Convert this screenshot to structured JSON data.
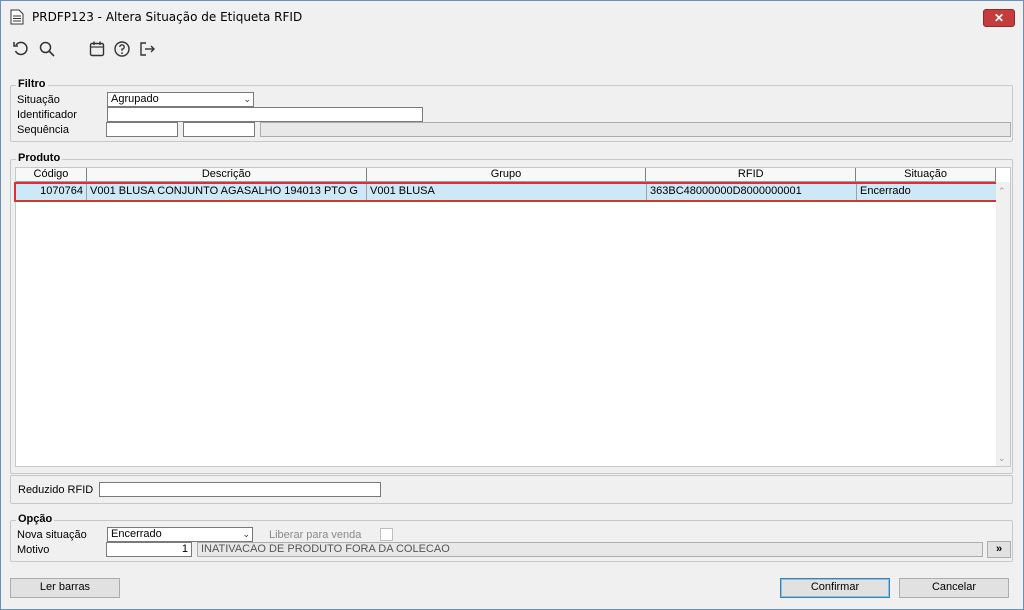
{
  "window": {
    "title": "PRDFP123 - Altera Situação de Etiqueta RFID",
    "close_label": "✕"
  },
  "toolbar": {
    "items": [
      {
        "name": "refresh-icon"
      },
      {
        "name": "search-icon"
      },
      {
        "name": "calendar-icon"
      },
      {
        "name": "help-icon"
      },
      {
        "name": "exit-icon"
      }
    ]
  },
  "filtro": {
    "title": "Filtro",
    "situacao_label": "Situação",
    "situacao_value": "Agrupado",
    "identificador_label": "Identificador",
    "identificador_value": "",
    "sequencia_label": "Sequência",
    "sequencia_from": "",
    "sequencia_to": ""
  },
  "produto": {
    "title": "Produto",
    "columns": [
      "Código",
      "Descrição",
      "Grupo",
      "RFID",
      "Situação"
    ],
    "rows": [
      {
        "codigo": "1070764",
        "descricao": "V001 BLUSA CONJUNTO AGASALHO 194013 PTO G",
        "grupo": "V001 BLUSA",
        "rfid": "363BC48000000D8000000001",
        "situacao": "Encerrado"
      }
    ]
  },
  "reduzido": {
    "label": "Reduzido RFID",
    "value": ""
  },
  "opcao": {
    "title": "Opção",
    "nova_situacao_label": "Nova situação",
    "nova_situacao_value": "Encerrado",
    "liberar_label": "Liberar para venda",
    "motivo_label": "Motivo",
    "motivo_code": "1",
    "motivo_desc": "INATIVACAO DE PRODUTO FORA DA COLECAO",
    "motivo_btn": "»"
  },
  "footer": {
    "ler_barras": "Ler barras",
    "confirmar": "Confirmar",
    "cancelar": "Cancelar"
  }
}
